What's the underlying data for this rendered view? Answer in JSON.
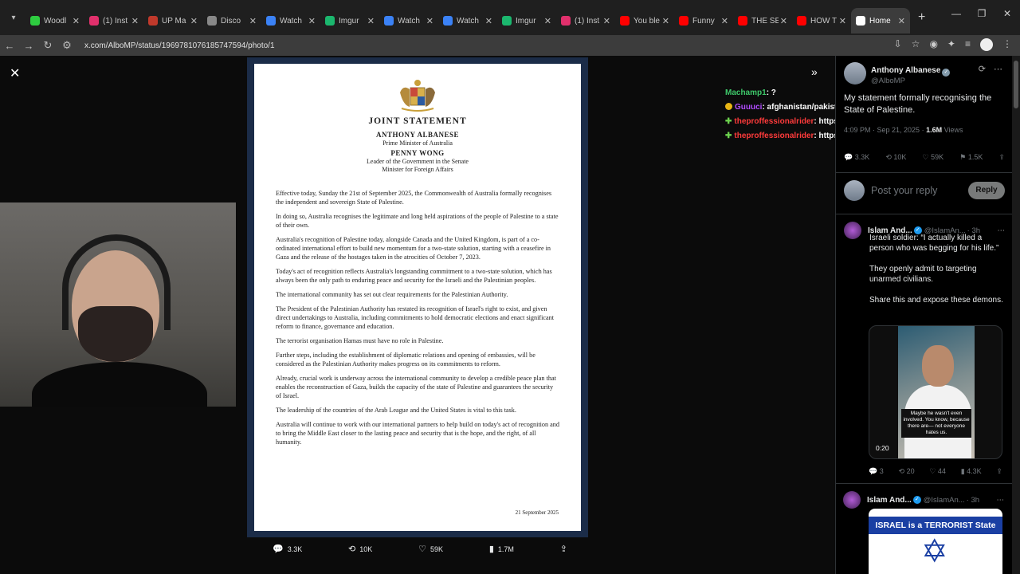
{
  "browser": {
    "tabs": [
      {
        "title": "Woodl",
        "color": "#2ecc40"
      },
      {
        "title": "(1) Inst",
        "color": "#e1306c"
      },
      {
        "title": "UP Ma",
        "color": "#c0392b"
      },
      {
        "title": "Disco",
        "color": "#888888"
      },
      {
        "title": "Watch",
        "color": "#3b82f6"
      },
      {
        "title": "Imgur",
        "color": "#1bb76e"
      },
      {
        "title": "Watch",
        "color": "#3b82f6"
      },
      {
        "title": "Watch",
        "color": "#3b82f6"
      },
      {
        "title": "Imgur",
        "color": "#1bb76e"
      },
      {
        "title": "(1) Inst",
        "color": "#e1306c"
      },
      {
        "title": "You ble",
        "color": "#ff0000"
      },
      {
        "title": "Funny",
        "color": "#ff0000"
      },
      {
        "title": "THE SE",
        "color": "#ff0000"
      },
      {
        "title": "HOW T",
        "color": "#ff0000"
      },
      {
        "title": "Home",
        "color": "#ffffff"
      }
    ],
    "url": "x.com/AlboMP/status/1969781076185747594/photo/1"
  },
  "document": {
    "title": "JOINT STATEMENT",
    "signatory1_name": "ANTHONY ALBANESE",
    "signatory1_role": "Prime Minister of Australia",
    "signatory2_name": "PENNY WONG",
    "signatory2_role_a": "Leader of the Government in the Senate",
    "signatory2_role_b": "Minister for Foreign Affairs",
    "paragraphs": [
      "Effective today, Sunday the 21st of September 2025, the Commonwealth of Australia formally recognises the independent and sovereign State of Palestine.",
      "In doing so, Australia recognises the legitimate and long held aspirations of the people of Palestine to a state of their own.",
      "Australia's recognition of Palestine today, alongside Canada and the United Kingdom, is part of a co-ordinated international effort to build new momentum for a two-state solution, starting with a ceasefire in Gaza and the release of the hostages taken in the atrocities of October 7, 2023.",
      "Today's act of recognition reflects Australia's longstanding commitment to a two-state solution, which has always been the only path to enduring peace and security for the Israeli and the Palestinian peoples.",
      "The international community has set out clear requirements for the Palestinian Authority.",
      "The President of the Palestinian Authority has restated its recognition of Israel's right to exist, and given direct undertakings to Australia, including commitments to hold democratic elections and enact significant reform to finance, governance and education.",
      "The terrorist organisation Hamas must have no role in Palestine.",
      "Further steps, including the establishment of diplomatic relations and opening of embassies, will be considered as the Palestinian Authority makes progress on its commitments to reform.",
      "Already, crucial work is underway across the international community to develop a credible peace plan that enables the reconstruction of Gaza, builds the capacity of the state of Palestine and guarantees the security of Israel.",
      "The leadership of the countries of the Arab League and the United States is vital to this task.",
      "Australia will continue to work with our international partners to help build on today's act of recognition and to bring the Middle East closer to the lasting peace and security that is the hope, and the right, of all humanity."
    ],
    "date": "21 September 2025"
  },
  "image_actions": {
    "replies": "3.3K",
    "reposts": "10K",
    "likes": "59K",
    "views": "1.7M"
  },
  "chat": [
    {
      "user": "Machamp1",
      "message": ": ?"
    },
    {
      "user": "Guuuci",
      "message": ": afghanistan/pakistan"
    },
    {
      "user": "theproffessionalrider",
      "message": ": https://streamable.com/nlguxx"
    },
    {
      "user": "theproffessionalrider",
      "message": ": https://streamable.com/cebvmu"
    }
  ],
  "post": {
    "author_name": "Anthony Albanese",
    "author_handle": "@AlboMP",
    "text": "My statement formally recognising the State of Palestine.",
    "time": "4:09 PM · Sep 21, 2025 ·",
    "views_count": "1.6M",
    "views_label": "Views",
    "replies": "3.3K",
    "reposts": "10K",
    "likes": "59K",
    "bookmarks": "1.5K",
    "reply_placeholder": "Post your reply",
    "reply_button": "Reply"
  },
  "replies": [
    {
      "author_name": "Islam And...",
      "author_handle": "@IslamAn...",
      "age": "· 3h",
      "text1": "Israeli soldier: “I actually killed a person who was begging for his life.”",
      "text2": "They openly admit to targeting unarmed civilians.",
      "text3": "Share this and expose these demons.",
      "video_caption": "Maybe he wasn't even involved. You know, because there are— not everyone hates us.",
      "video_time": "0:20",
      "replies": "3",
      "reposts": "20",
      "likes": "44",
      "views": "4.3K"
    },
    {
      "author_name": "Islam And...",
      "author_handle": "@IslamAn...",
      "age": "· 3h",
      "image_text": "ISRAEL is a TERRORIST State"
    }
  ]
}
